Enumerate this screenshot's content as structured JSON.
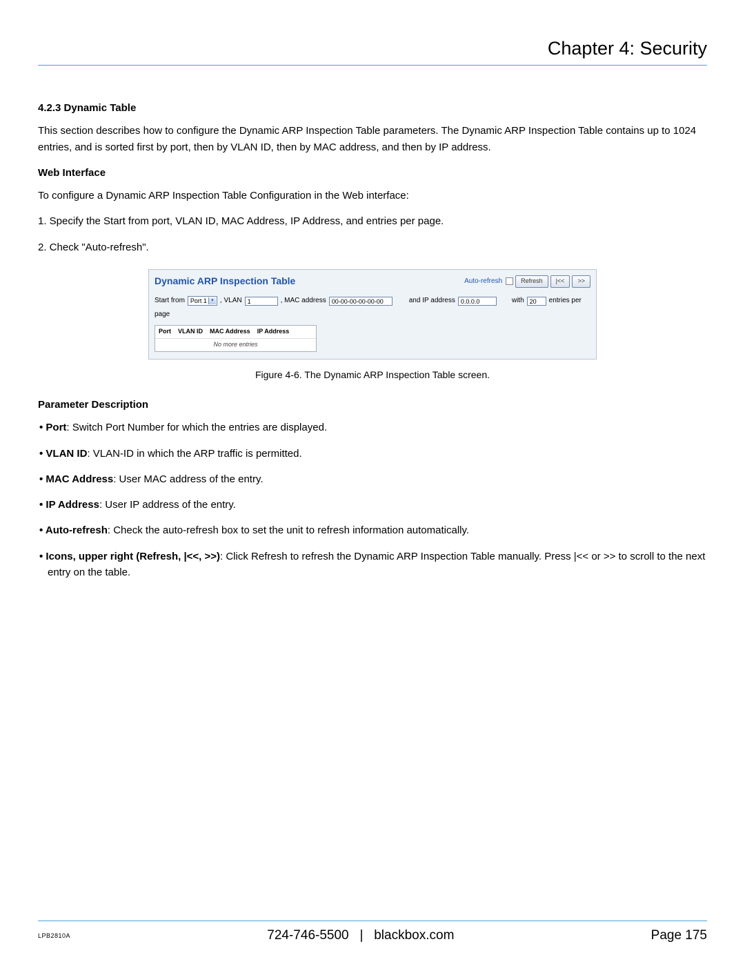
{
  "header": {
    "chapter": "Chapter 4: Security"
  },
  "section": {
    "num_title": "4.2.3 Dynamic Table",
    "intro": "This section describes how to configure the Dynamic ARP Inspection Table parameters. The Dynamic ARP Inspection Table contains up to 1024 entries, and is sorted first by port, then by VLAN ID, then by MAC address, and then by IP address.",
    "web_interface_h": "Web Interface",
    "web_interface_lead": "To configure a Dynamic ARP Inspection Table Configuration in the Web interface:",
    "step1": "1. Specify the Start from port, VLAN ID, MAC Address, IP Address, and entries per page.",
    "step2": "2. Check \"Auto-refresh\"."
  },
  "app": {
    "title": "Dynamic ARP Inspection Table",
    "auto_refresh": "Auto-refresh",
    "refresh_btn": "Refresh",
    "prev_btn": "|<<",
    "next_btn": ">>",
    "filter": {
      "start_from": "Start from",
      "port_sel": "Port 1",
      "comma_vlan": ", VLAN",
      "vlan_val": "1",
      "comma_mac": ", MAC address",
      "mac_val": "00-00-00-00-00-00",
      "and_ip": "and IP address",
      "ip_val": "0.0.0.0",
      "with": "with",
      "with_val": "20",
      "entries_per": "entries per",
      "page_word": "page"
    },
    "table": {
      "h1": "Port",
      "h2": "VLAN ID",
      "h3": "MAC Address",
      "h4": "IP Address",
      "empty": "No more entries"
    }
  },
  "figure_caption": "Figure 4-6. The Dynamic ARP Inspection Table screen.",
  "params": {
    "heading": "Parameter Description",
    "items": [
      {
        "b": "Port",
        "t": ": Switch Port Number for which the entries are displayed."
      },
      {
        "b": "VLAN ID",
        "t": ": VLAN-ID in which the ARP traffic is permitted."
      },
      {
        "b": "MAC Address",
        "t": ": User MAC address of the entry."
      },
      {
        "b": "IP Address",
        "t": ": User IP address of the entry."
      },
      {
        "b": "Auto-refresh",
        "t": ": Check the auto-refresh box to set the unit to refresh information automatically."
      },
      {
        "b": "Icons, upper right (Refresh, |<<, >>)",
        "t": ": Click Refresh to refresh the Dynamic ARP Inspection Table manually. Press |<< or >> to scroll to the next entry on the table."
      }
    ]
  },
  "footer": {
    "model": "LPB2810A",
    "phone": "724-746-5500",
    "sep": "|",
    "site": "blackbox.com",
    "page": "Page 175"
  }
}
